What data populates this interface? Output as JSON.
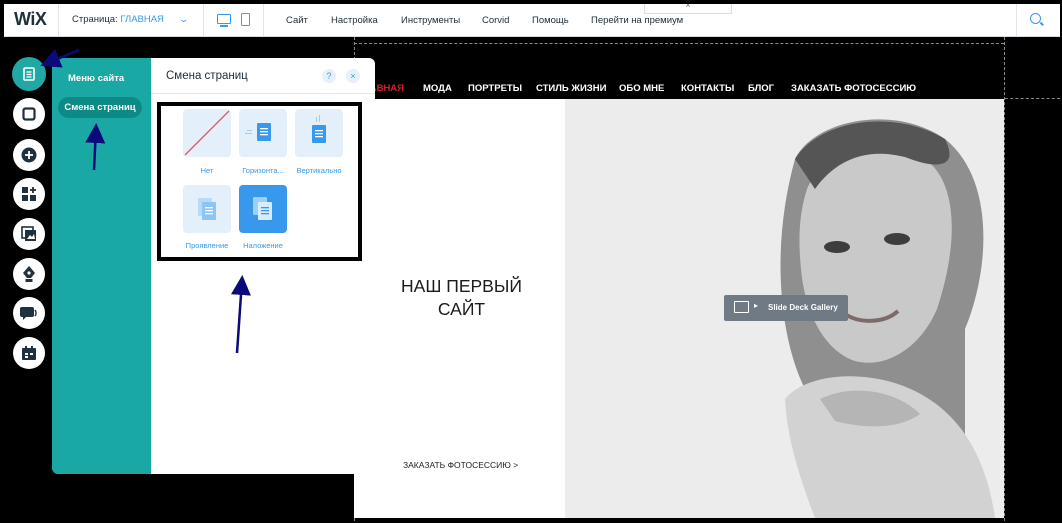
{
  "topbar": {
    "logo": "WiX",
    "page_selector_prefix": "Страница: ",
    "page_selector_value": "ГЛАВНАЯ",
    "menu": [
      "Сайт",
      "Настройка",
      "Инструменты",
      "Corvid",
      "Помощь",
      "Перейти на премиум"
    ],
    "collapse_tab": "^"
  },
  "site": {
    "nav": [
      "ГЛАВНАЯ",
      "МОДА",
      "ПОРТРЕТЫ",
      "СТИЛЬ ЖИЗНИ",
      "ОБО МНЕ",
      "КОНТАКТЫ",
      "БЛОГ",
      "ЗАКАЗАТЬ ФОТОСЕССИЮ"
    ],
    "hero_title_line1": "НАШ ПЕРВЫЙ",
    "hero_title_line2": "САЙТ",
    "hero_cta": "ЗАКАЗАТЬ ФОТОСЕССИЮ >",
    "gallery_label": "Slide Deck Gallery"
  },
  "rail": {
    "icons": [
      "pages-icon",
      "background-icon",
      "add-icon",
      "apps-icon",
      "media-icon",
      "blog-pen-icon",
      "chat-icon",
      "bookings-icon"
    ],
    "active": "pages-icon"
  },
  "pages_panel": {
    "menu_items": [
      "Меню сайта",
      "Смена страниц"
    ],
    "selected_item": "Смена страниц",
    "title": "Смена страниц",
    "help": "?",
    "close": "×",
    "options": [
      {
        "label": "Нет",
        "selected": false
      },
      {
        "label": "Горизонта...",
        "selected": false
      },
      {
        "label": "Вертикально",
        "selected": false
      },
      {
        "label": "Проявление",
        "selected": false
      },
      {
        "label": "Наложение",
        "selected": true
      }
    ]
  },
  "colors": {
    "accent_blue": "#3899ec",
    "panel_teal": "#1aa8a5",
    "active_nav_red": "#d42020",
    "annotation_arrow": "#0a0a7a"
  }
}
